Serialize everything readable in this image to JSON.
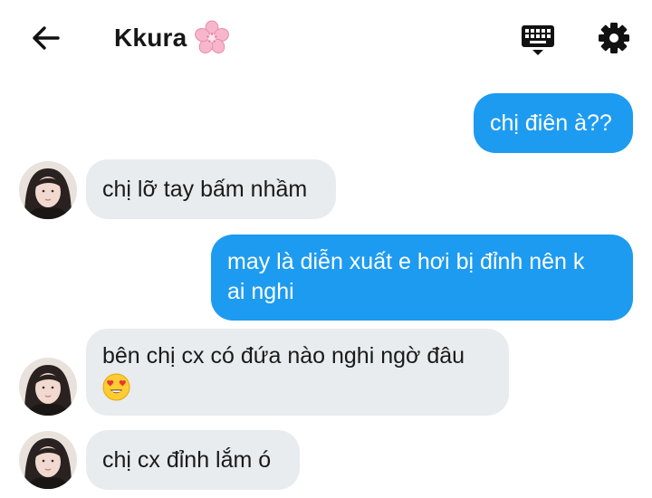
{
  "header": {
    "contact_name": "Kkura",
    "back_icon": "arrow-left-icon",
    "name_emoji": "cherry-blossom-icon",
    "keyboard_icon": "keyboard-icon",
    "settings_icon": "gear-icon"
  },
  "messages": [
    {
      "direction": "outgoing",
      "text": "chị điên à??"
    },
    {
      "direction": "incoming",
      "text": "chị lỡ tay bấm nhầm"
    },
    {
      "direction": "outgoing",
      "text": "may là diễn xuất e hơi bị đỉnh nên k\nai nghi"
    },
    {
      "direction": "incoming",
      "text": "bên chị cx có đứa nào nghi ngờ đâu",
      "emoji": "heart-eyes-emoji"
    },
    {
      "direction": "incoming",
      "text": "chị cx đỉnh lắm ó"
    }
  ],
  "colors": {
    "outgoing_bubble": "#1d9bf0",
    "incoming_bubble": "#e8ecef",
    "header_icons": "#111111"
  }
}
